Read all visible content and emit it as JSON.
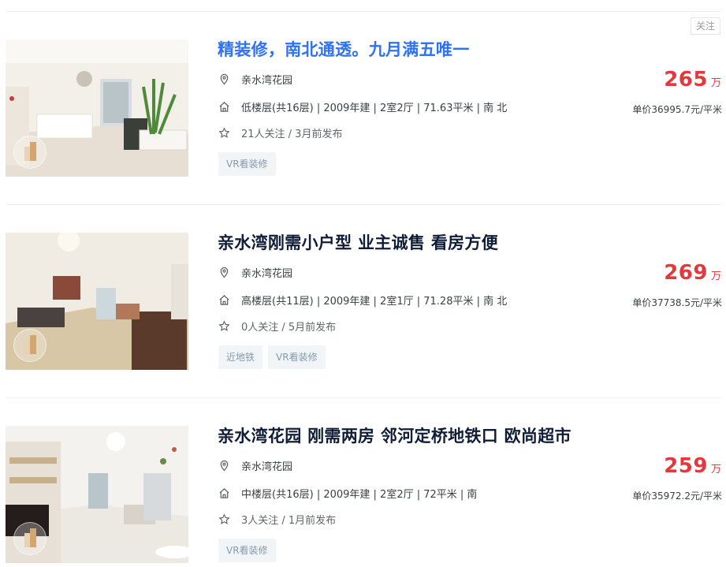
{
  "follow_button": {
    "label": "关注"
  },
  "listings": [
    {
      "title": "精装修，南北通透。九月满五唯一",
      "community": "亲水湾花园",
      "house_info": "低楼层(共16层) | 2009年建 | 2室2厅 | 71.63平米 | 南 北",
      "follow_info": "21人关注 / 3月前发布",
      "tags": [
        "VR看装修"
      ],
      "price": "265",
      "price_unit": "万",
      "unit_price": "单价36995.7元/平米"
    },
    {
      "title": "亲水湾刚需小户型 业主诚售 看房方便",
      "community": "亲水湾花园",
      "house_info": "高楼层(共11层) | 2009年建 | 2室1厅 | 71.28平米 | 南 北",
      "follow_info": "0人关注 / 5月前发布",
      "tags": [
        "近地铁",
        "VR看装修"
      ],
      "price": "269",
      "price_unit": "万",
      "unit_price": "单价37738.5元/平米"
    },
    {
      "title": "亲水湾花园 刚需两房 邻河定桥地铁口 欧尚超市",
      "community": "亲水湾花园",
      "house_info": "中楼层(共16层) | 2009年建 | 2室2厅 | 72平米 | 南",
      "follow_info": "3人关注 / 1月前发布",
      "tags": [
        "VR看装修"
      ],
      "price": "259",
      "price_unit": "万",
      "unit_price": "单价35972.2元/平米"
    }
  ],
  "icons": {
    "location": "location-pin-icon",
    "house": "house-icon",
    "star": "star-icon",
    "vr": "vr-badge-icon"
  },
  "colors": {
    "title": "#101d37",
    "title_active": "#3072f6",
    "price": "#e4393c",
    "tag_bg": "#f2f5f7",
    "tag_text": "#849aae"
  }
}
